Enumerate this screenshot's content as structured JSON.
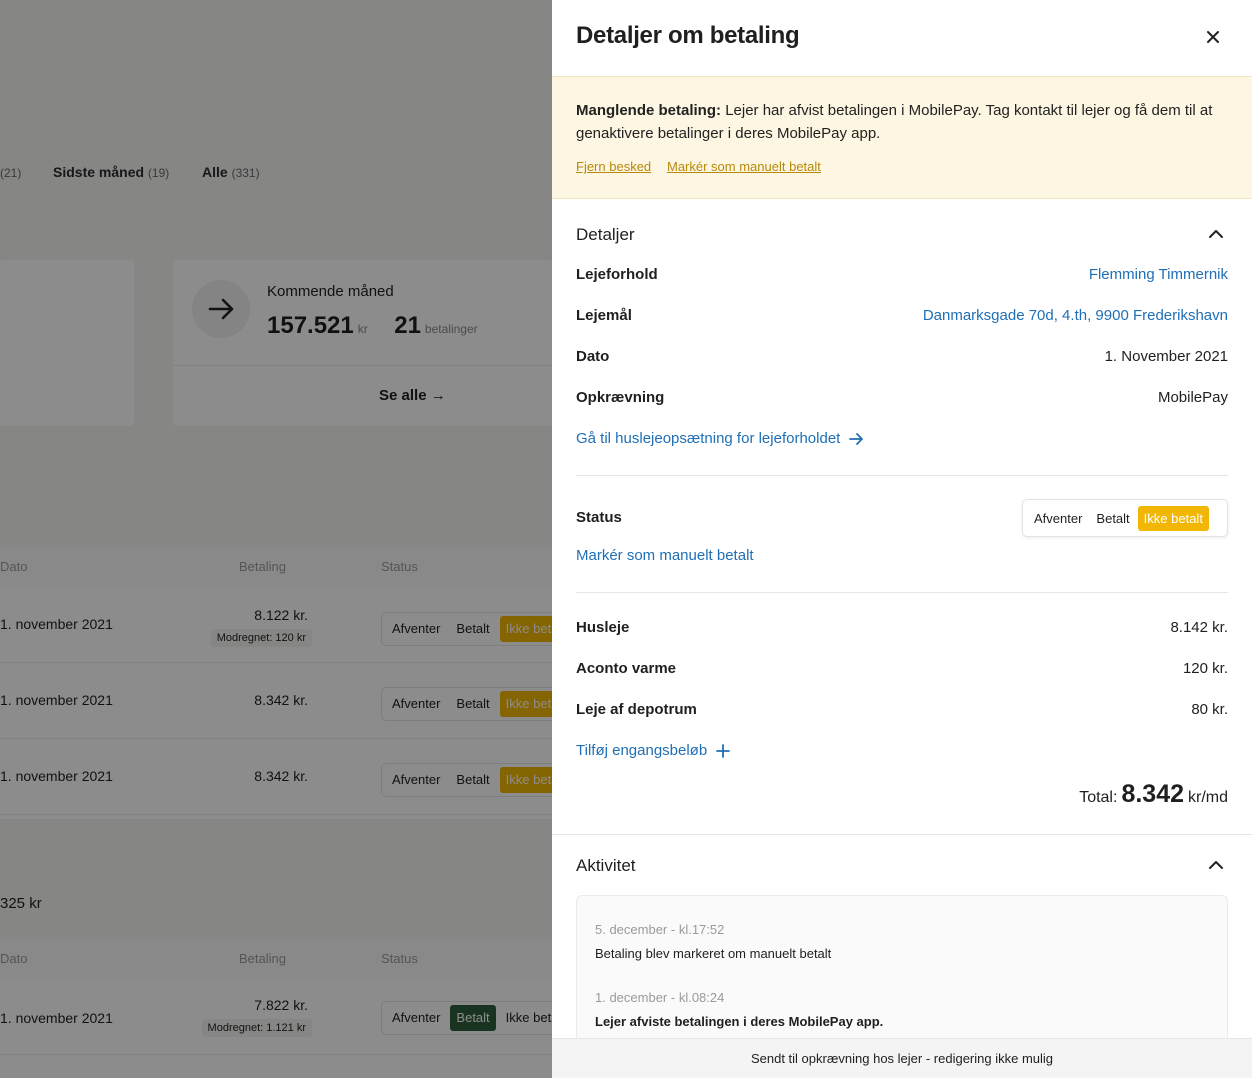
{
  "background": {
    "tabs": [
      {
        "label": "",
        "count": "(21)"
      },
      {
        "label": "Sidste måned",
        "count": "(19)"
      },
      {
        "label": "Alle",
        "count": "(331)"
      }
    ],
    "upcoming": {
      "label": "Kommende måned",
      "amount": "157.521",
      "amount_unit": "kr",
      "count": "21",
      "count_unit": "betalinger",
      "see_all": "Se alle"
    },
    "table_headers": [
      "Dato",
      "Betaling",
      "Status"
    ],
    "rows1": [
      {
        "date": "1. november 2021",
        "amount": "8.122 kr.",
        "offset": "Modregnet: 120 kr"
      },
      {
        "date": "1. november 2021",
        "amount": "8.342 kr.",
        "offset": ""
      },
      {
        "date": "1. november 2021",
        "amount": "8.342 kr.",
        "offset": ""
      }
    ],
    "status_opts": [
      "Afventer",
      "Betalt",
      "Ikke betalt"
    ],
    "group2_total": "325 kr",
    "rows2": [
      {
        "date": "1. november 2021",
        "amount": "7.822 kr.",
        "offset": "Modregnet: 1.121 kr"
      }
    ]
  },
  "panel": {
    "title": "Detaljer om betaling",
    "alert": {
      "bold": "Manglende betaling:",
      "text": "Lejer har afvist betalingen i MobilePay. Tag kontakt til lejer og få dem til at genaktivere betalinger i deres MobilePay app.",
      "dismiss": "Fjern besked",
      "mark_paid": "Markér som manuelt betalt"
    },
    "details": {
      "title": "Detaljer",
      "rows": [
        {
          "key": "Lejeforhold",
          "value": "Flemming Timmernik",
          "link": true
        },
        {
          "key": "Lejemål",
          "value": "Danmarksgade 70d, 4.th, 9900 Frederikshavn",
          "link": true
        },
        {
          "key": "Dato",
          "value": "1. November 2021",
          "link": false
        },
        {
          "key": "Opkrævning",
          "value": "MobilePay",
          "link": false
        }
      ],
      "setup_link": "Gå til huslejeopsætning for lejeforholdet"
    },
    "status": {
      "label": "Status",
      "options": [
        "Afventer",
        "Betalt",
        "Ikke betalt"
      ],
      "active": "Ikke betalt",
      "mark_link": "Markér som manuelt betalt"
    },
    "lines": [
      {
        "key": "Husleje",
        "value": "8.142 kr."
      },
      {
        "key": "Aconto varme",
        "value": "120 kr."
      },
      {
        "key": "Leje af depotrum",
        "value": "80 kr."
      }
    ],
    "add_link": "Tilføj engangsbeløb",
    "total": {
      "label": "Total:",
      "amount": "8.342",
      "unit": "kr/md"
    },
    "activity": {
      "title": "Aktivitet",
      "items": [
        {
          "date": "5. december - kl.17:52",
          "text": "Betaling blev markeret om manuelt betalt",
          "bold": false
        },
        {
          "date": "1. december - kl.08:24",
          "text": "Lejer afviste betalingen i deres MobilePay app.",
          "bold": true
        }
      ]
    },
    "footer": "Sendt til opkrævning hos lejer - redigering ikke mulig"
  },
  "colors": {
    "accent_link": "#1f6fb6",
    "status_yellow": "#f2b705",
    "alert_bg": "#fdf6e2",
    "paid_green": "#2f5d3c"
  }
}
